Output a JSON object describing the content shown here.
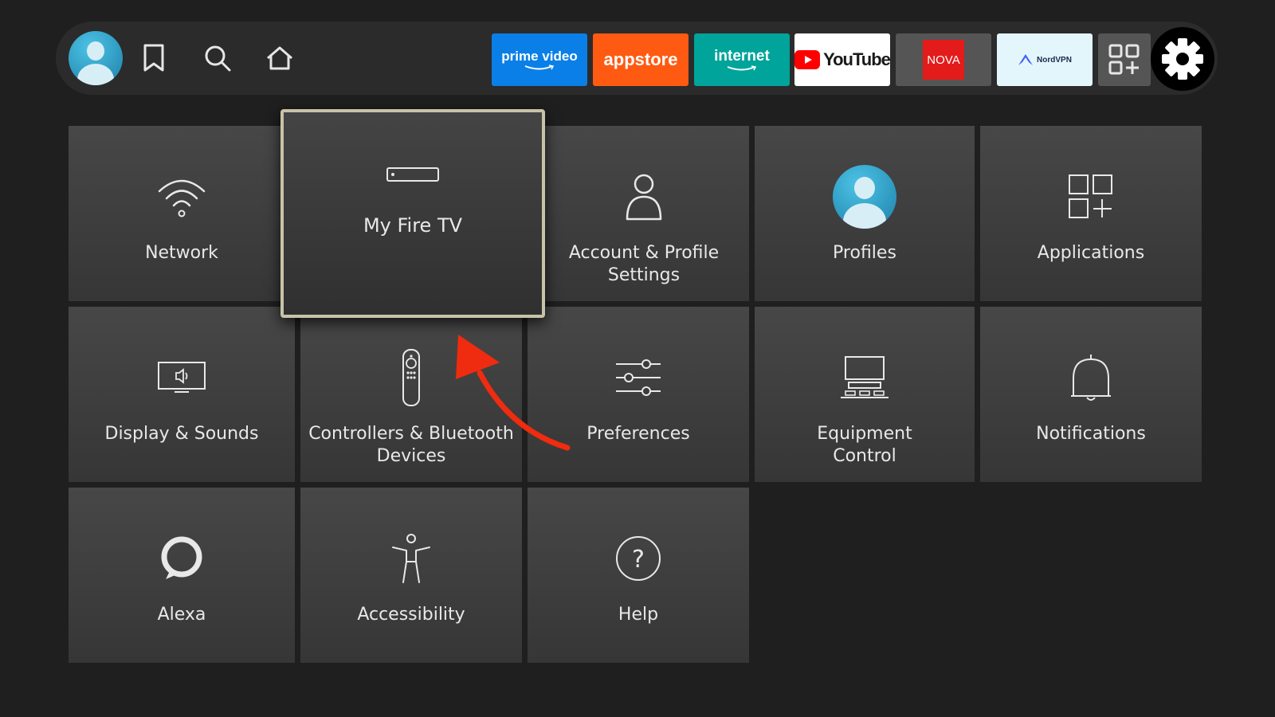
{
  "colors": {
    "background": "#1f1f1f",
    "nav_bar": "#2b2b2b",
    "tile": "#404040",
    "focus_border": "#c8c3a6",
    "annotation_arrow": "#ef2b10"
  },
  "nav": {
    "icons": [
      "profile-avatar",
      "bookmark-icon",
      "search-icon",
      "home-icon"
    ],
    "apps": [
      {
        "label": "prime video",
        "bg": "#0a7fe8",
        "fg": "#ffffff"
      },
      {
        "label": "appstore",
        "bg": "#ff5a12",
        "fg": "#ffffff"
      },
      {
        "label": "internet",
        "bg": "#00a49a",
        "fg": "#ffffff"
      },
      {
        "label": "YouTube",
        "bg": "#ffffff",
        "fg": "#1a1a1a"
      },
      {
        "label": "NOVA",
        "bg": "#555555",
        "fg": "#ffffff"
      },
      {
        "label": "NordVPN",
        "bg": "#e3f6fc",
        "fg": "#1b2a4a"
      }
    ],
    "all_apps_icon": "apps-grid-icon",
    "settings_icon": "settings-gear-icon"
  },
  "settings": {
    "network": "Network",
    "my_fire_tv": "My Fire TV",
    "account_line1": "Account & Profile",
    "account_line2": "Settings",
    "profiles": "Profiles",
    "applications": "Applications",
    "display_sounds": "Display & Sounds",
    "controllers_line1": "Controllers & Bluetooth",
    "controllers_line2": "Devices",
    "preferences": "Preferences",
    "equipment_line1": "Equipment",
    "equipment_line2": "Control",
    "notifications": "Notifications",
    "alexa": "Alexa",
    "accessibility": "Accessibility",
    "help": "Help"
  }
}
